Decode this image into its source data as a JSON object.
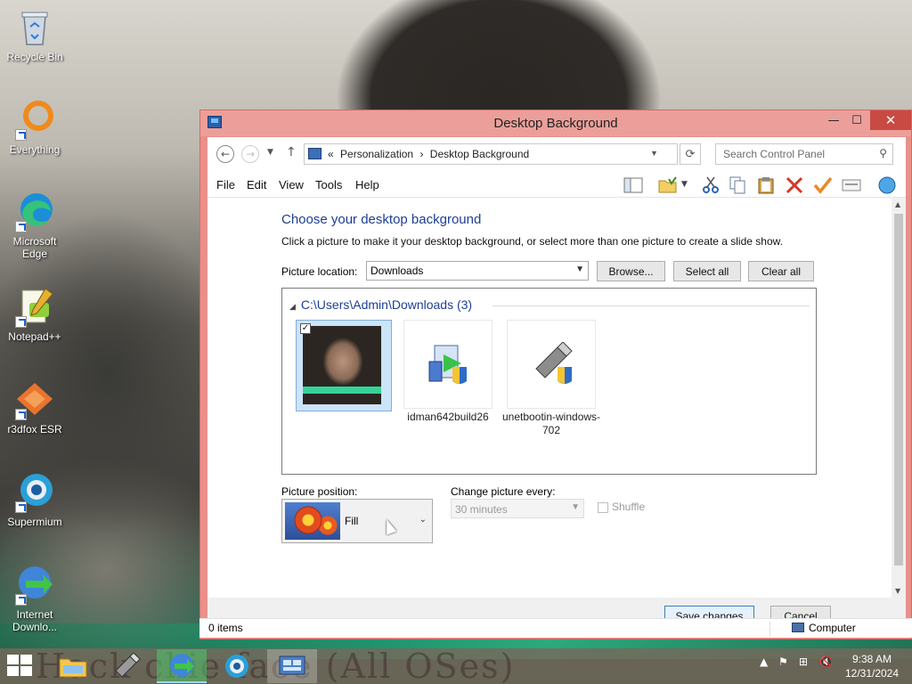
{
  "desktop": {
    "icons": [
      {
        "label": "Recycle Bin",
        "icon": "recycle-bin-icon"
      },
      {
        "label": "Everything",
        "icon": "everything-icon"
      },
      {
        "label": "Microsoft Edge",
        "icon": "edge-icon"
      },
      {
        "label": "Notepad++",
        "icon": "notepad-plus-plus-icon"
      },
      {
        "label": "r3dfox ESR",
        "icon": "r3dfox-icon"
      },
      {
        "label": "Supermium",
        "icon": "supermium-icon"
      },
      {
        "label": "Internet Downlo...",
        "icon": "internet-download-manager-icon"
      }
    ]
  },
  "window": {
    "title": "Desktop Background",
    "controls": {
      "minimize": "—",
      "maximize": "☐",
      "close": "✕"
    },
    "address": {
      "prefix": "«",
      "crumbs": [
        "Personalization",
        "Desktop Background"
      ],
      "separator": "›"
    },
    "search_placeholder": "Search Control Panel",
    "menu": [
      "File",
      "Edit",
      "View",
      "Tools",
      "Help"
    ],
    "content": {
      "heading": "Choose your desktop background",
      "subtext": "Click a picture to make it your desktop background, or select more than one picture to create a slide show.",
      "picture_location_label": "Picture location:",
      "picture_location_value": "Downloads",
      "browse_label": "Browse...",
      "select_all_label": "Select all",
      "clear_all_label": "Clear all",
      "folder_header": "C:\\Users\\Admin\\Downloads (3)",
      "pictures": [
        {
          "caption": "",
          "checked": true,
          "selected": true,
          "check_mark": "✓"
        },
        {
          "caption": "idman642build26",
          "checked": false,
          "selected": false
        },
        {
          "caption": "unetbootin-windows-702",
          "checked": false,
          "selected": false
        }
      ],
      "picture_position_label": "Picture position:",
      "picture_position_value": "Fill",
      "change_every_label": "Change picture every:",
      "change_every_value": "30 minutes",
      "shuffle_label": "Shuffle"
    },
    "footer": {
      "save_label": "Save changes",
      "cancel_label": "Cancel"
    },
    "status": {
      "items": "0 items",
      "location": "Computer"
    }
  },
  "taskbar": {
    "overlay_text": "Hack  ckie face (All OSes)",
    "clock_time": "9:38 AM",
    "clock_date": "12/31/2024"
  },
  "colors": {
    "window_frame": "#e9908b",
    "heading_blue": "#1e3f93",
    "close_red": "#c84a42"
  }
}
